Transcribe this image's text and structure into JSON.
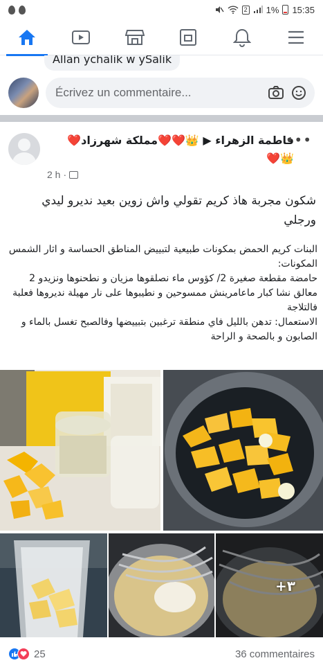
{
  "status_bar": {
    "battery_percent": "1%",
    "time": "15:35",
    "sim_badge": "2"
  },
  "nav": {
    "items": [
      "home-icon",
      "watch-icon",
      "marketplace-icon",
      "groups-icon",
      "notifications-icon",
      "menu-icon"
    ],
    "active": "home",
    "accent": "#1877f2"
  },
  "previous_comment": {
    "text": "Allan ychalik w ySalik"
  },
  "composer": {
    "placeholder": "Écrivez un commentaire..."
  },
  "post": {
    "author_line": "فاطمة الزهراء ▶ 👑❤️❤️مملكة شهرزاد❤️",
    "author_line2": "👑❤️",
    "author_primary": "فاطمة الزهراء",
    "group_name": "مملكة شهرزاد",
    "time": "2 h",
    "headline": "شكون مجربة هاذ كريم تقولي واش زوين بعيد نديرو ليدي ورجلي",
    "recipe_lines": [
      "البنات كريم الحمض بمكونات طبيعية لتبييض المناطق الحساسة و اثار الشمس",
      "المكونات:",
      "حامضة مقطعة صغيرة 2/ كؤوس ماء نصلقوها مزيان و نطحنوها ونزيدو 2 معالق نشا كبار ماعامرينش ممسوحين و نطيبوها على نار مهيلة نديروها فعلبة فالتلاجة",
      "الاستعمال: تدهن بالليل فاي منطقة ترغبين بتبييضها وفالصبح تغسل بالماء و الصابون و بالصحة و الراحة"
    ],
    "image_badge": "+٣",
    "reactions_count": "25",
    "comments_count": "36 commentaires"
  }
}
